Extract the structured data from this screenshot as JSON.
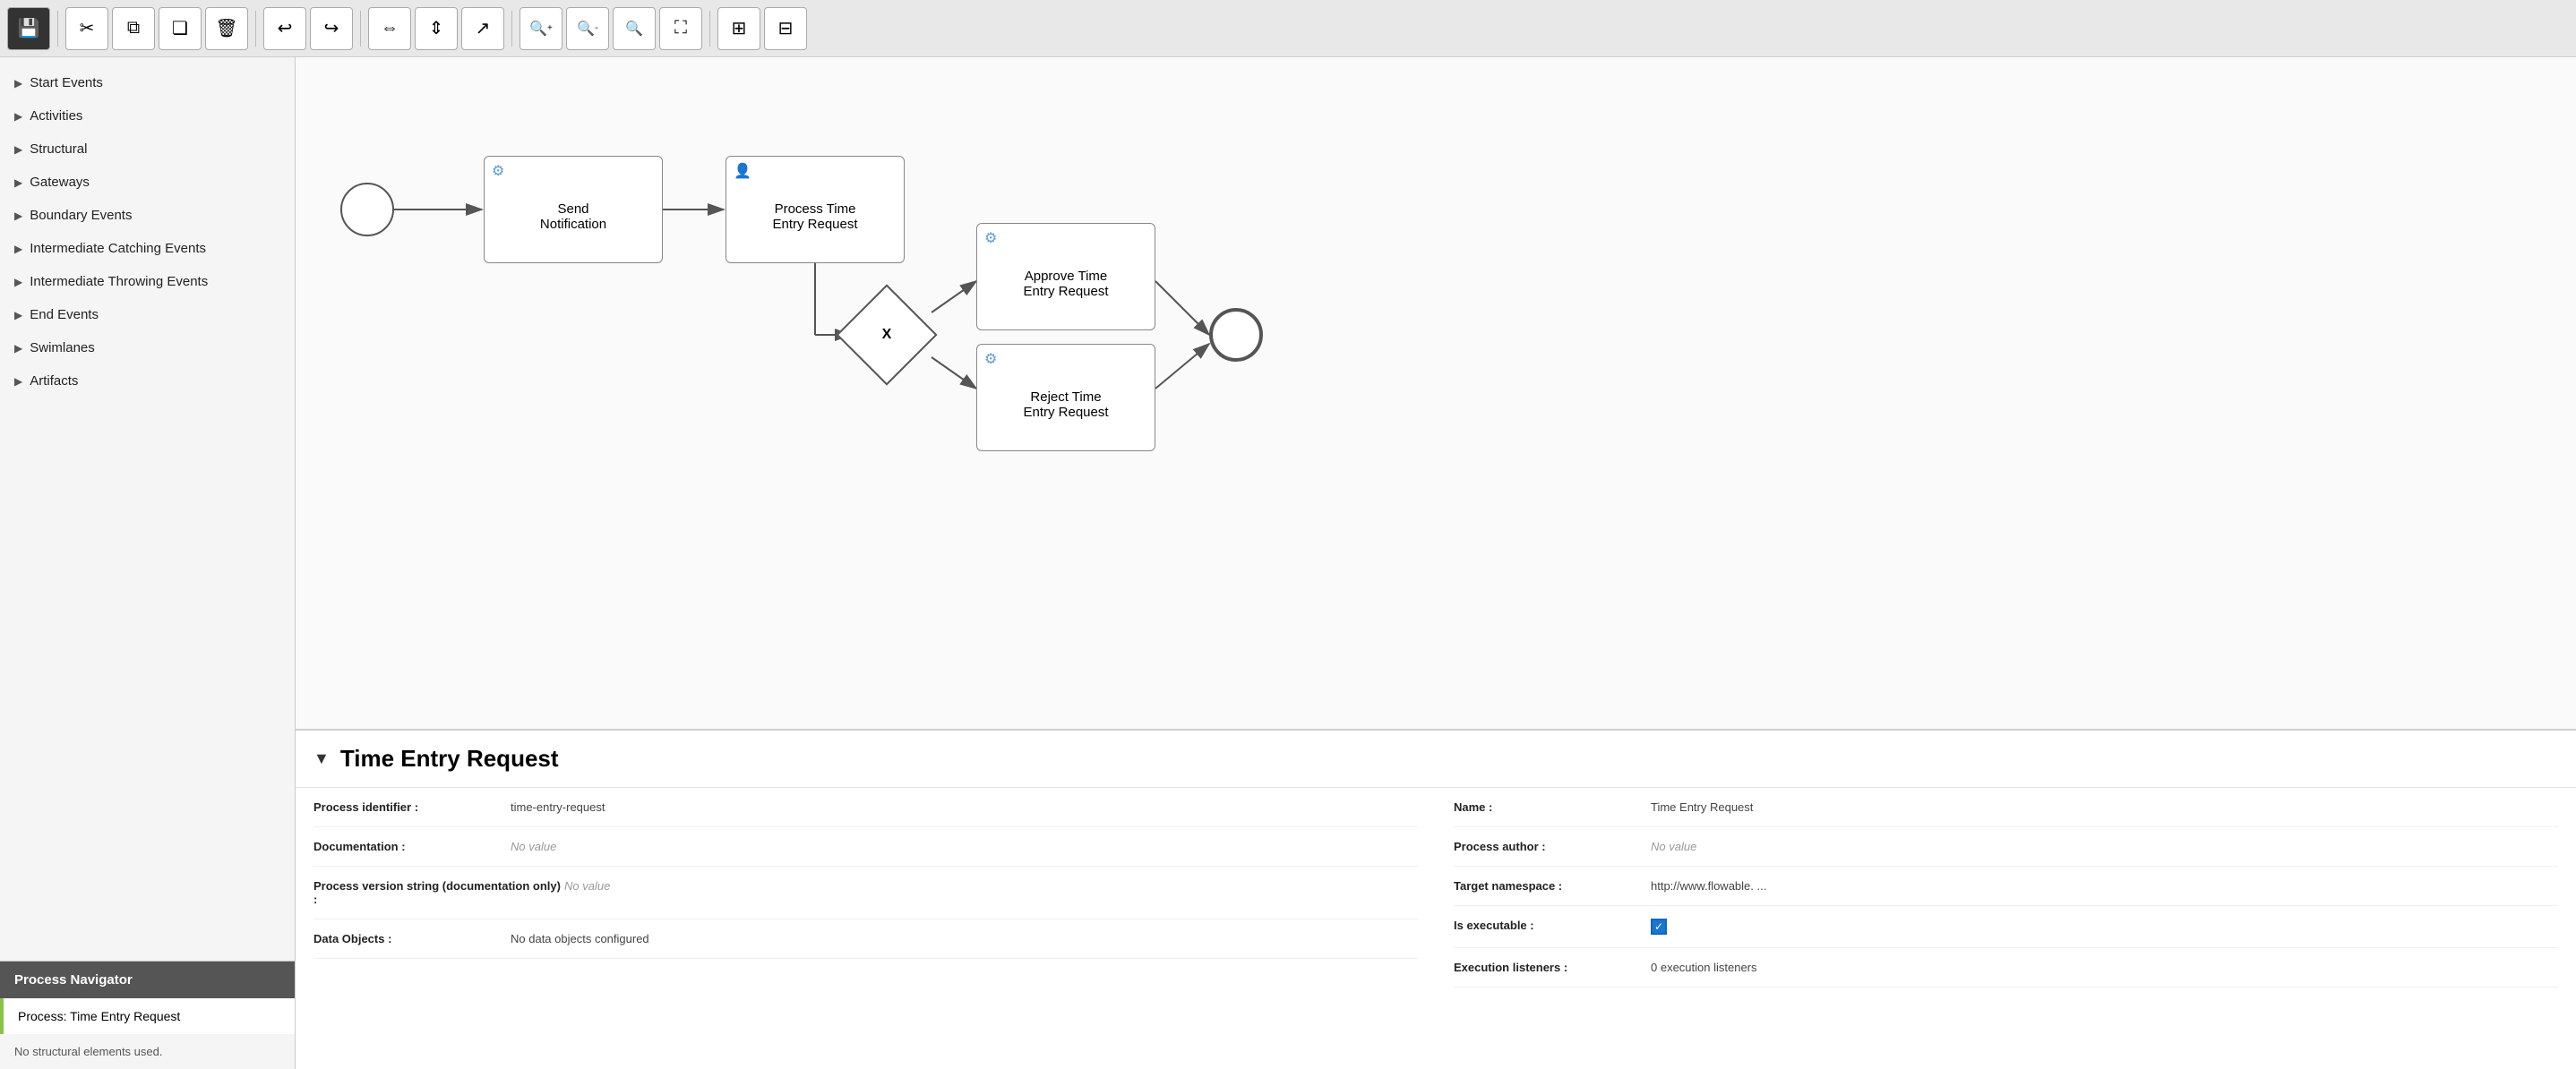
{
  "toolbar": {
    "buttons": [
      {
        "id": "save",
        "label": "💾",
        "active": true,
        "title": "Save"
      },
      {
        "id": "cut",
        "label": "✂",
        "active": false,
        "title": "Cut"
      },
      {
        "id": "copy",
        "label": "⧉",
        "active": false,
        "title": "Copy"
      },
      {
        "id": "paste",
        "label": "📋",
        "active": false,
        "title": "Paste"
      },
      {
        "id": "delete",
        "label": "🗑",
        "active": false,
        "title": "Delete"
      },
      {
        "id": "undo",
        "label": "↩",
        "active": false,
        "title": "Undo"
      },
      {
        "id": "redo",
        "label": "↪",
        "active": false,
        "title": "Redo"
      },
      {
        "id": "align-h",
        "label": "⇔",
        "active": false,
        "title": "Align Horizontal"
      },
      {
        "id": "align-v",
        "label": "⇕",
        "active": false,
        "title": "Align Vertical"
      },
      {
        "id": "connect",
        "label": "↗",
        "active": false,
        "title": "Connect"
      },
      {
        "id": "zoom-in",
        "label": "🔍+",
        "active": false,
        "title": "Zoom In"
      },
      {
        "id": "zoom-out",
        "label": "🔍-",
        "active": false,
        "title": "Zoom Out"
      },
      {
        "id": "zoom-fit",
        "label": "🔍",
        "active": false,
        "title": "Zoom Fit"
      },
      {
        "id": "fullscreen",
        "label": "⛶",
        "active": false,
        "title": "Fullscreen"
      },
      {
        "id": "layout1",
        "label": "⊞",
        "active": false,
        "title": "Layout 1"
      },
      {
        "id": "layout2",
        "label": "⊟",
        "active": false,
        "title": "Layout 2"
      }
    ]
  },
  "sidebar": {
    "items": [
      {
        "id": "start-events",
        "label": "Start Events"
      },
      {
        "id": "activities",
        "label": "Activities"
      },
      {
        "id": "structural",
        "label": "Structural"
      },
      {
        "id": "gateways",
        "label": "Gateways"
      },
      {
        "id": "boundary-events",
        "label": "Boundary Events"
      },
      {
        "id": "intermediate-catching",
        "label": "Intermediate Catching Events"
      },
      {
        "id": "intermediate-throwing",
        "label": "Intermediate Throwing Events"
      },
      {
        "id": "end-events",
        "label": "End Events"
      },
      {
        "id": "swimlanes",
        "label": "Swimlanes"
      },
      {
        "id": "artifacts",
        "label": "Artifacts"
      }
    ]
  },
  "process_navigator": {
    "header": "Process Navigator",
    "process_item": "Process: Time Entry Request",
    "note": "No structural elements used."
  },
  "diagram": {
    "nodes": [
      {
        "id": "start",
        "type": "start",
        "label": ""
      },
      {
        "id": "send-notification",
        "type": "task",
        "label": "Send Notification",
        "icon": "gear"
      },
      {
        "id": "process-time-entry",
        "type": "task",
        "label": "Process Time\nEntry Request",
        "icon": "person"
      },
      {
        "id": "gateway",
        "type": "gateway",
        "label": "X"
      },
      {
        "id": "approve-time-entry",
        "type": "task",
        "label": "Approve Time\nEntry Request",
        "icon": "gear"
      },
      {
        "id": "reject-time-entry",
        "type": "task",
        "label": "Reject Time\nEntry Request",
        "icon": "gear"
      },
      {
        "id": "end",
        "type": "end",
        "label": ""
      }
    ]
  },
  "properties": {
    "title": "Time Entry Request",
    "fields": {
      "process_identifier_label": "Process identifier :",
      "process_identifier_value": "time-entry-request",
      "documentation_label": "Documentation :",
      "documentation_value": "No value",
      "process_version_label": "Process version string (documentation only) :",
      "process_version_value": "No value",
      "data_objects_label": "Data Objects :",
      "data_objects_value": "No data objects configured",
      "name_label": "Name :",
      "name_value": "Time Entry Request",
      "process_author_label": "Process author :",
      "process_author_value": "No value",
      "target_namespace_label": "Target namespace :",
      "target_namespace_value": "http://www.flowable. ...",
      "is_executable_label": "Is executable :",
      "execution_listeners_label": "Execution listeners :",
      "execution_listeners_value": "0 execution listeners"
    }
  }
}
